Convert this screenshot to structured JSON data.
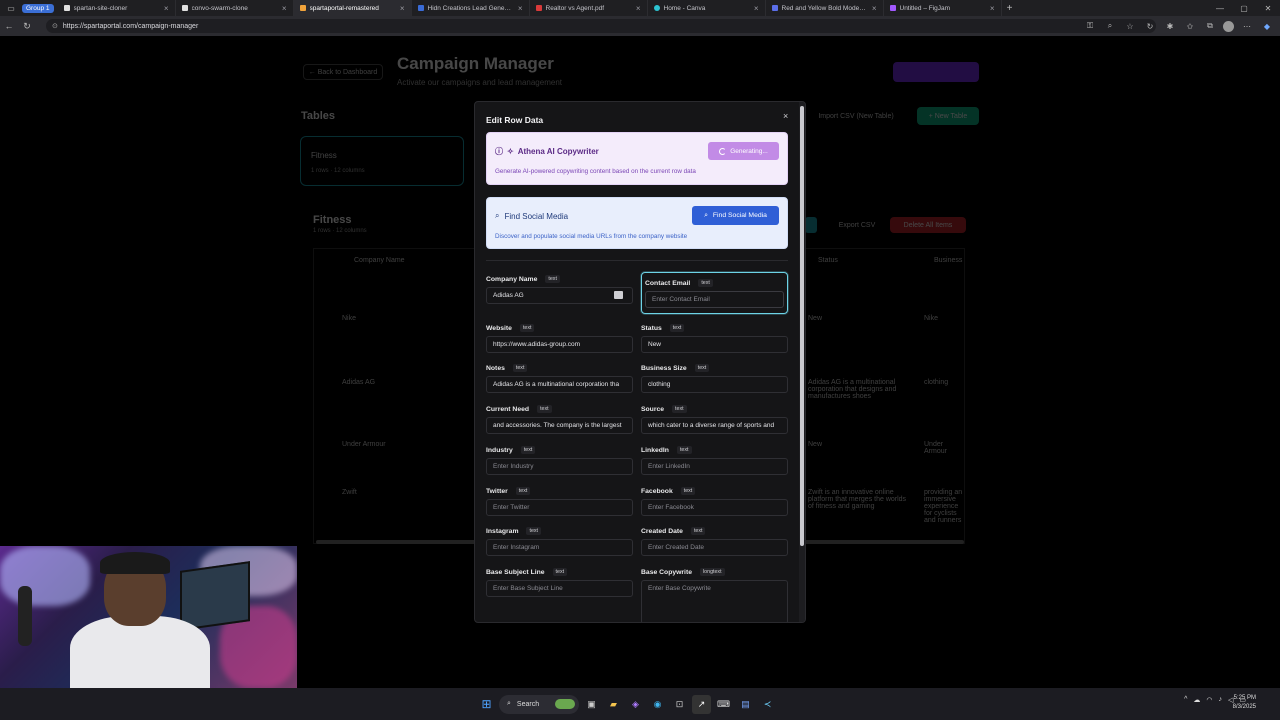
{
  "browser": {
    "tab_group": "Group 1",
    "tabs": [
      {
        "label": "spartan-site-cloner",
        "color": "#e0e0e0",
        "active": false
      },
      {
        "label": "convo-swarm-clone",
        "color": "#e0e0e0",
        "active": false
      },
      {
        "label": "spartaportal-remastered",
        "color": "#f1a33b",
        "active": true
      },
      {
        "label": "Hidn Creations Lead Generator -",
        "color": "#3a6bd6",
        "active": false
      },
      {
        "label": "Realtor vs Agent.pdf",
        "color": "#d93a3a",
        "active": false
      },
      {
        "label": "Home - Canva",
        "color": "#2cc3d1",
        "active": false
      },
      {
        "label": "Red and Yellow Bold Modern You",
        "color": "#5b6ee8",
        "active": false
      },
      {
        "label": "Untitled – FigJam",
        "color": "#a259ff",
        "active": false
      }
    ],
    "url": "https://spartaportal.com/campaign-manager"
  },
  "app": {
    "back_label": "← Back to Dashboard",
    "title": "Campaign Manager",
    "subtitle": "Activate our campaigns and lead management",
    "tables_title": "Tables",
    "import_label": "Import CSV (New Table)",
    "new_table_label": "+ New Table",
    "table_card_name": "Fitness",
    "table_card_meta": "1 rows · 12 columns",
    "section_title": "Fitness",
    "section_sub": "1 rows · 12 columns",
    "export_label": "Export CSV",
    "delete_label": "Delete All Items",
    "column_header": "Company Name",
    "column_header_2": "Status",
    "column_header_3": "Business",
    "rows": [
      {
        "name": "Nike",
        "status": "New",
        "business": "Nike"
      },
      {
        "name": "Adidas AG",
        "status": "Adidas AG is a multinational corporation that designs and manufactures shoes",
        "business": "clothing"
      },
      {
        "name": "Under Armour",
        "status": "New",
        "business": "Under Armour"
      },
      {
        "name": "Zwift",
        "status": "Zwift is an innovative online platform that merges the worlds of fitness and gaming",
        "business": "providing an immersive experience for cyclists and runners"
      }
    ]
  },
  "modal": {
    "title": "Edit Row Data",
    "close": "×",
    "ai": {
      "title": "Athena AI Copywriter",
      "description": "Generate AI-powered copywriting content based on the current row data",
      "button": "Generating..."
    },
    "social": {
      "title": "Find Social Media",
      "description": "Discover and populate social media URLs from the company website",
      "button": "Find Social Media"
    },
    "fields": {
      "company_name": {
        "label": "Company Name",
        "type": "text",
        "value": "Adidas AG"
      },
      "contact_email": {
        "label": "Contact Email",
        "type": "text",
        "placeholder": "Enter Contact Email"
      },
      "website": {
        "label": "Website",
        "type": "text",
        "value": "https://www.adidas-group.com"
      },
      "status": {
        "label": "Status",
        "type": "text",
        "value": "New"
      },
      "notes": {
        "label": "Notes",
        "type": "text",
        "value": "Adidas AG is a multinational corporation tha"
      },
      "business_size": {
        "label": "Business Size",
        "type": "text",
        "value": "clothing"
      },
      "current_need": {
        "label": "Current Need",
        "type": "text",
        "value": "and accessories. The company is the largest"
      },
      "source": {
        "label": "Source",
        "type": "text",
        "value": "which cater to a diverse range of sports and"
      },
      "industry": {
        "label": "Industry",
        "type": "text",
        "placeholder": "Enter Industry"
      },
      "linkedin": {
        "label": "LinkedIn",
        "type": "text",
        "placeholder": "Enter LinkedIn"
      },
      "twitter": {
        "label": "Twitter",
        "type": "text",
        "placeholder": "Enter Twitter"
      },
      "facebook": {
        "label": "Facebook",
        "type": "text",
        "placeholder": "Enter Facebook"
      },
      "instagram": {
        "label": "Instagram",
        "type": "text",
        "placeholder": "Enter Instagram"
      },
      "created_date": {
        "label": "Created Date",
        "type": "text",
        "placeholder": "Enter Created Date"
      },
      "base_subject_line": {
        "label": "Base Subject Line",
        "type": "text",
        "placeholder": "Enter Base Subject Line"
      },
      "base_copywrite": {
        "label": "Base Copywrite",
        "type": "longtext",
        "placeholder": "Enter Base Copywrite"
      }
    }
  },
  "taskbar": {
    "search_label": "Search",
    "time": "5:25 PM",
    "date": "8/3/2025"
  },
  "colors": {
    "ai_button": "#c28be6",
    "social_button": "#2f5fd6",
    "focus_ring": "#6dd3e6",
    "new_table": "#0fb88a",
    "delete": "#c0262e"
  }
}
